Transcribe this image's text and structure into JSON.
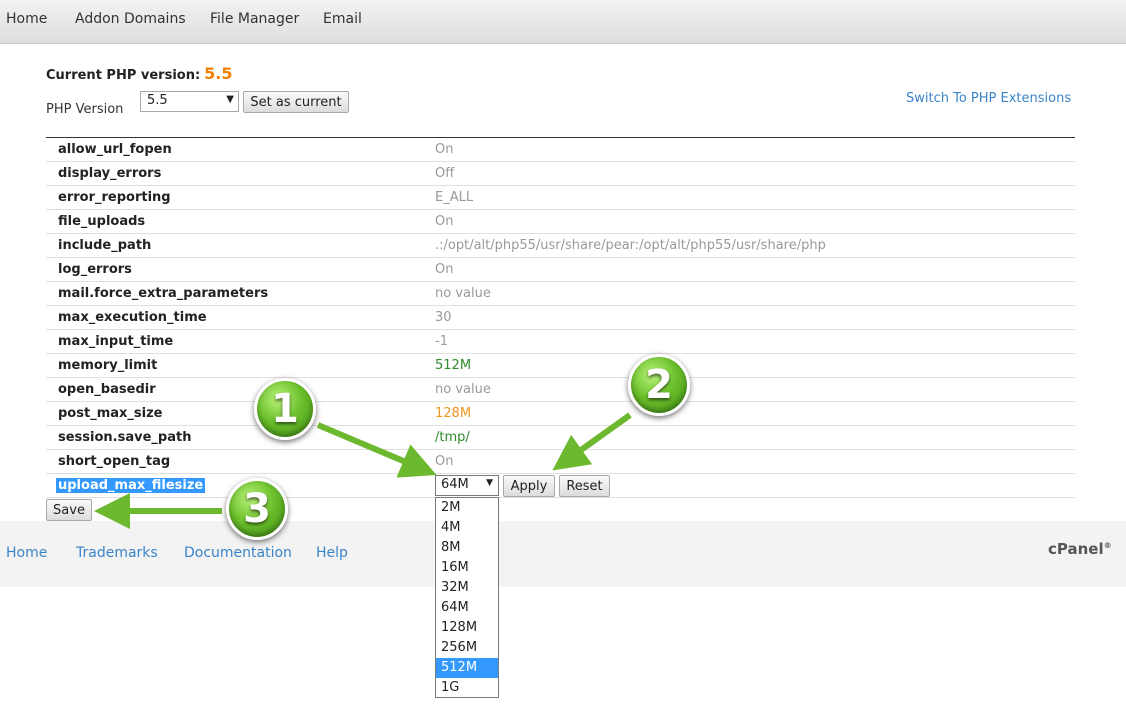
{
  "nav": {
    "items": [
      "Home",
      "Addon Domains",
      "File Manager",
      "Email"
    ]
  },
  "php": {
    "current_label": "Current PHP version:",
    "current_value": "5.5",
    "version_label": "PHP Version",
    "selected_version": "5.5",
    "set_current_button": "Set as current",
    "extensions_link": "Switch To PHP Extensions"
  },
  "options": [
    {
      "name": "allow_url_fopen",
      "value": "On"
    },
    {
      "name": "display_errors",
      "value": "Off"
    },
    {
      "name": "error_reporting",
      "value": "E_ALL"
    },
    {
      "name": "file_uploads",
      "value": "On"
    },
    {
      "name": "include_path",
      "value": ".:/opt/alt/php55/usr/share/pear:/opt/alt/php55/usr/share/php"
    },
    {
      "name": "log_errors",
      "value": "On"
    },
    {
      "name": "mail.force_extra_parameters",
      "value": "no value"
    },
    {
      "name": "max_execution_time",
      "value": "30"
    },
    {
      "name": "max_input_time",
      "value": "-1"
    },
    {
      "name": "memory_limit",
      "value": "512M"
    },
    {
      "name": "open_basedir",
      "value": "no value"
    },
    {
      "name": "post_max_size",
      "value": "128M"
    },
    {
      "name": "session.save_path",
      "value": "/tmp/"
    },
    {
      "name": "short_open_tag",
      "value": "On"
    }
  ],
  "upload": {
    "name": "upload_max_filesize",
    "selected": "64M",
    "apply_button": "Apply",
    "reset_button": "Reset",
    "dropdown_options": [
      "2M",
      "4M",
      "8M",
      "16M",
      "32M",
      "64M",
      "128M",
      "256M",
      "512M",
      "1G"
    ],
    "highlighted_option": "512M"
  },
  "save_button": "Save",
  "footer": {
    "links": [
      "Home",
      "Trademarks",
      "Documentation",
      "Help"
    ],
    "logo": "cPanel",
    "logo_mark": "®"
  },
  "callouts": [
    "1",
    "2",
    "3"
  ],
  "colors": {
    "link": "#3b84c9",
    "version_accent": "#f08000",
    "value_green": "#2e8b2e",
    "value_orange": "#f0951e",
    "selection": "#3399ff",
    "callout_green": "#6cc12c"
  }
}
